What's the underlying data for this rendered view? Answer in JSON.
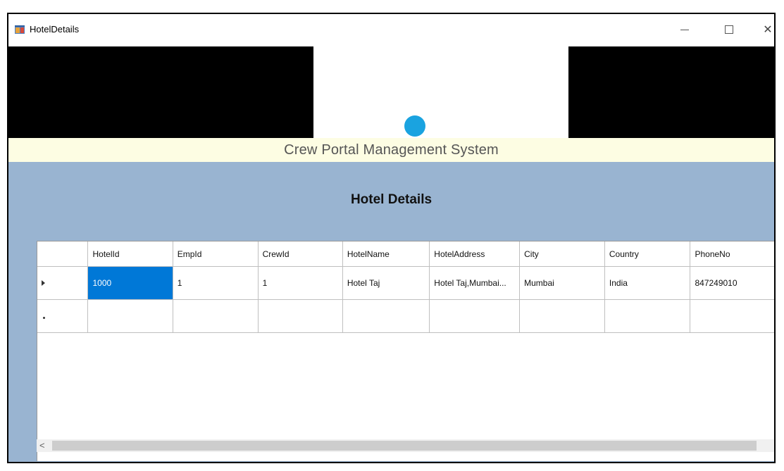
{
  "window": {
    "title": "HotelDetails",
    "icon": "form-app-icon"
  },
  "banner": {
    "system_title": "Crew Portal Management System",
    "logo_color": "#1aa3e0"
  },
  "page": {
    "title": "Hotel Details"
  },
  "grid": {
    "columns": [
      "HotelId",
      "EmpId",
      "CrewId",
      "HotelName",
      "HotelAddress",
      "City",
      "Country",
      "PhoneNo"
    ],
    "rows": [
      {
        "hotel_id": "1000",
        "emp_id": "1",
        "crew_id": "1",
        "hotel_name": "Hotel Taj",
        "hotel_address": "Hotel Taj,Mumbai...",
        "city": "Mumbai",
        "country": "India",
        "phone": "847249010"
      }
    ],
    "selection_color": "#0078d7"
  }
}
